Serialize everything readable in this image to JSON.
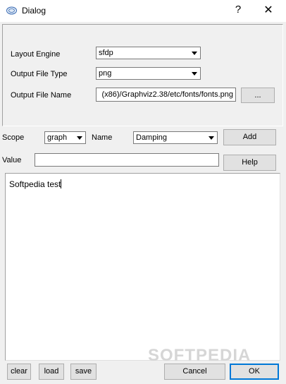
{
  "window": {
    "title": "Dialog",
    "help_glyph": "?",
    "close_glyph": "✕"
  },
  "layout_engine": {
    "label": "Layout Engine",
    "value": "sfdp"
  },
  "output_file_type": {
    "label": "Output File Type",
    "value": "png"
  },
  "output_file_name": {
    "label": "Output File Name",
    "value": "(x86)/Graphviz2.38/etc/fonts/fonts.png",
    "browse_label": "..."
  },
  "attribute": {
    "scope_label": "Scope",
    "scope_value": "graph",
    "name_label": "Name",
    "name_value": "Damping",
    "add_label": "Add",
    "value_label": "Value",
    "value_value": "",
    "help_label": "Help"
  },
  "editor": {
    "text": "Softpedia test"
  },
  "footer": {
    "clear_label": "clear",
    "load_label": "load",
    "save_label": "save",
    "cancel_label": "Cancel",
    "ok_label": "OK"
  },
  "watermark": {
    "text": "SOFTPEDIA"
  }
}
